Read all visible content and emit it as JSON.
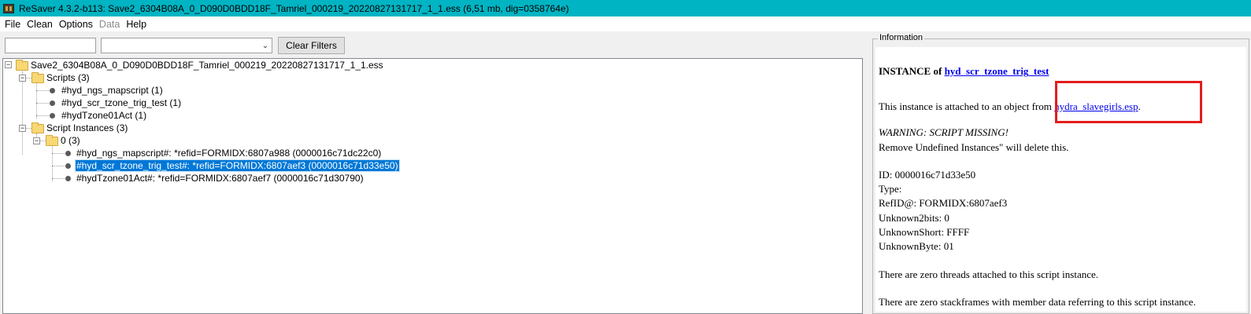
{
  "window": {
    "title": "ReSaver 4.3.2-b113: Save2_6304B08A_0_D090D0BDD18F_Tamriel_000219_20220827131717_1_1.ess (6,51 mb, dig=0358764e)"
  },
  "menu": [
    "File",
    "Clean",
    "Options",
    "Data",
    "Help"
  ],
  "filter": {
    "text_value": "",
    "combo_value": "",
    "clear_label": "Clear Filters"
  },
  "tree": {
    "root": "Save2_6304B08A_0_D090D0BDD18F_Tamriel_000219_20220827131717_1_1.ess",
    "scripts_label": "Scripts (3)",
    "scripts": [
      "#hyd_ngs_mapscript (1)",
      "#hyd_scr_tzone_trig_test (1)",
      "#hydTzone01Act (1)"
    ],
    "instances_label": "Script Instances (3)",
    "group_label": "0 (3)",
    "instances": [
      "#hyd_ngs_mapscript#: *refid=FORMIDX:6807a988 (0000016c71dc22c0)",
      "#hyd_scr_tzone_trig_test#: *refid=FORMIDX:6807aef3 (0000016c71d33e50)",
      "#hydTzone01Act#: *refid=FORMIDX:6807aef7 (0000016c71d30790)"
    ]
  },
  "info": {
    "group_title": "Information",
    "heading_prefix": "INSTANCE of ",
    "heading_link": "hyd_scr_tzone_trig_test",
    "attached_prefix": "This instance is attached to an object from ",
    "attached_link": "hydra_slavegirls.esp",
    "attached_suffix": ".",
    "warning": "WARNING: SCRIPT MISSING!",
    "remove_note": "Remove Undefined Instances\" will delete this.",
    "id": "ID: 0000016c71d33e50",
    "type": "Type:",
    "refid": "RefID@: FORMIDX:6807aef3",
    "unknown2bits": "Unknown2bits: 0",
    "unknownshort": "UnknownShort: FFFF",
    "unknownbyte": "UnknownByte: 01",
    "threads": "There are zero threads attached to this script instance.",
    "stackframes": "There are zero stackframes with member data referring to this script instance."
  },
  "colors": {
    "titlebar": "#00b4c3",
    "selection": "#0078d7",
    "link": "#0000ee",
    "annotation": "#e31d1d"
  }
}
